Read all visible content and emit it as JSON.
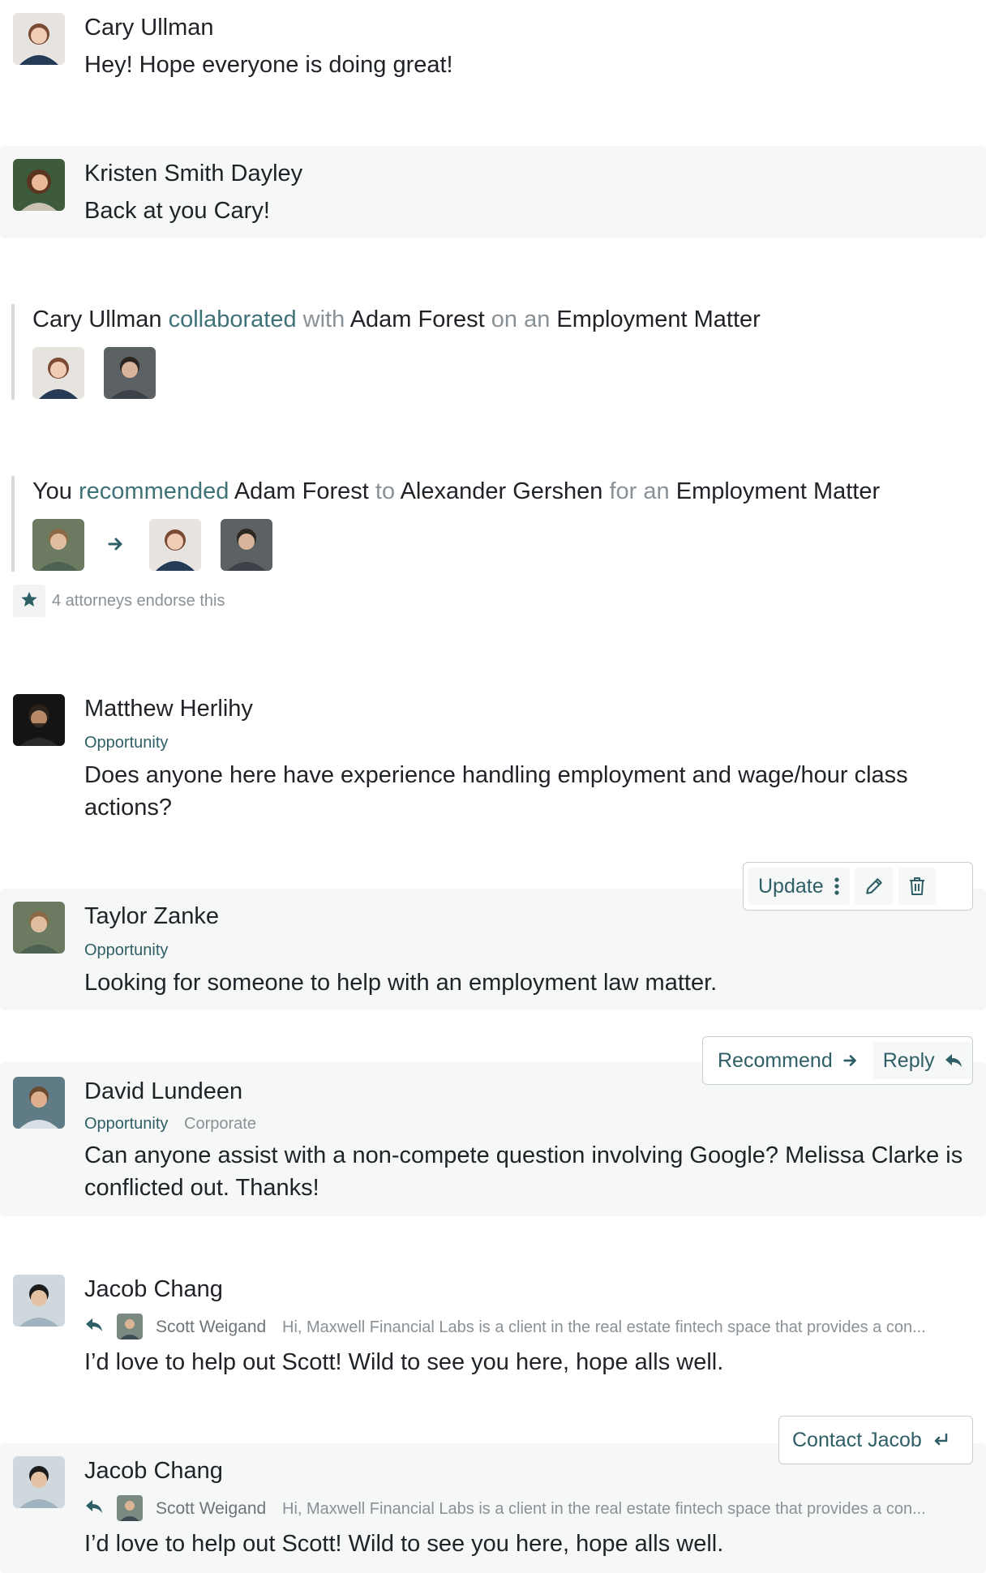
{
  "feed": {
    "m1": {
      "name": "Cary Ullman",
      "text": "Hey! Hope everyone is doing great!"
    },
    "m2": {
      "name": "Kristen Smith Dayley",
      "text": "Back at you Cary!"
    },
    "a1": {
      "actor": "Cary Ullman",
      "verb": "collaborated",
      "prep1": "with",
      "target": "Adam Forest",
      "prep2": "on an",
      "matter": "Employment Matter"
    },
    "a2": {
      "actor": "You",
      "verb": "recommended",
      "target": "Adam Forest",
      "prep1": "to",
      "recipient": "Alexander Gershen",
      "prep2": "for an",
      "matter": "Employment Matter",
      "endorse": "4 attorneys endorse this"
    },
    "m3": {
      "name": "Matthew Herlihy",
      "tag": "Opportunity",
      "text": "Does anyone here have experience handling employment and wage/hour class actions?"
    },
    "m4": {
      "name": "Taylor Zanke",
      "tag": "Opportunity",
      "text": "Looking for someone to help with an employment law matter.",
      "toolbar": {
        "update": "Update"
      }
    },
    "m5": {
      "name": "David Lundeen",
      "tag": "Opportunity",
      "tag2": "Corporate",
      "text": "Can anyone assist with a non-compete question involving Google? Melissa Clarke is conflicted out. Thanks!",
      "toolbar": {
        "recommend": "Recommend",
        "reply": "Reply"
      }
    },
    "m6": {
      "name": "Jacob Chang",
      "quote_name": "Scott Weigand",
      "quote_text": "Hi, Maxwell Financial Labs is a client in the real estate fintech space that provides a con...",
      "text": "I’d love to help out Scott! Wild to see you here, hope alls well."
    },
    "m7": {
      "name": "Jacob Chang",
      "quote_name": "Scott Weigand",
      "quote_text": "Hi, Maxwell Financial Labs is a client in the real estate fintech space that provides a con...",
      "text": "I’d love to help out Scott! Wild to see you here, hope alls well.",
      "toolbar": {
        "contact": "Contact Jacob"
      }
    }
  },
  "colors": {
    "accent": "#2f5f66",
    "muted": "#8a9196",
    "row_bg": "#f6f7f7"
  },
  "icons": [
    "more-vertical-icon",
    "pencil-icon",
    "trash-icon",
    "arrow-right-icon",
    "reply-icon",
    "enter-icon",
    "star-icon"
  ]
}
